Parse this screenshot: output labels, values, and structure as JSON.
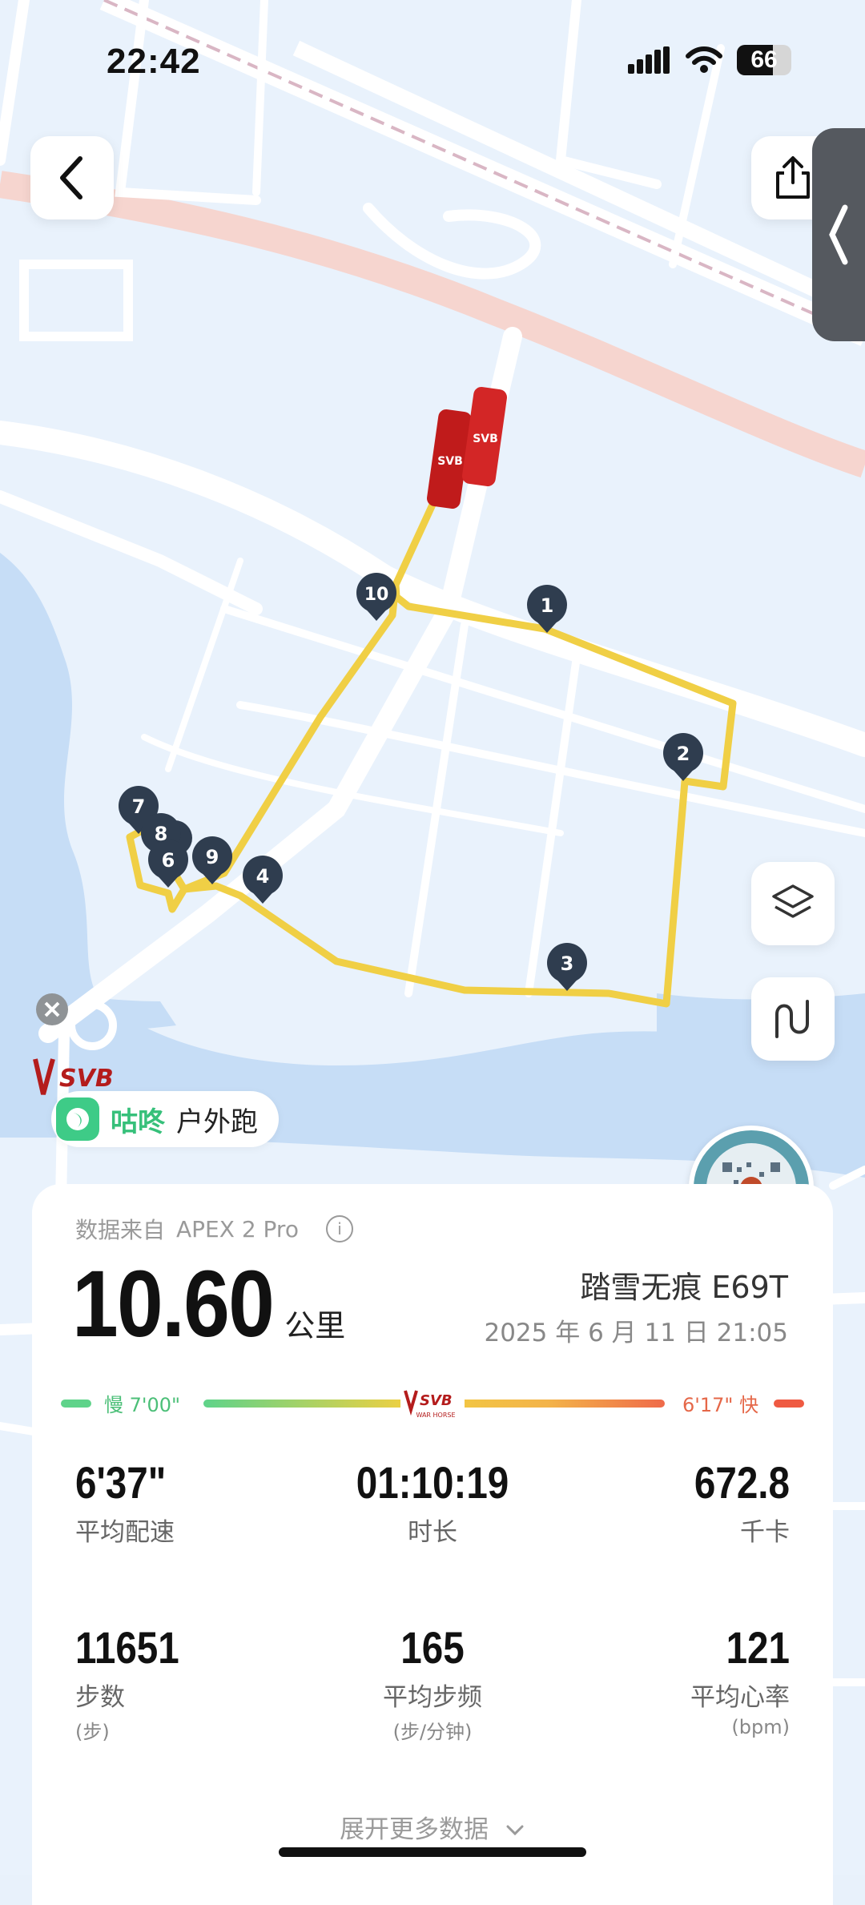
{
  "status_bar": {
    "time": "22:42",
    "battery": "66"
  },
  "route": {
    "markers": [
      "1",
      "2",
      "3",
      "4",
      "6",
      "7",
      "8",
      "9",
      "10"
    ],
    "start_badge_text": "SVB"
  },
  "brand": {
    "app_name": "咕咚",
    "activity": "户外跑",
    "sponsor_text": "SVB"
  },
  "summary": {
    "source_label": "数据来自",
    "device": "APEX 2 Pro",
    "distance": "10.60",
    "distance_unit": "公里",
    "shoe": "踏雪无痕 E69T",
    "datetime": "2025 年 6 月 11 日 21:05"
  },
  "pace_range": {
    "slow_label": "慢 7'00\"",
    "fast_label": "6'17\" 快",
    "center_logo_text": "SVB",
    "center_logo_sub": "WAR HORSE",
    "colors": {
      "slow": "#5fd38a",
      "fast": "#ef5a42"
    }
  },
  "stats": [
    {
      "value": "6'37\"",
      "label": "平均配速"
    },
    {
      "value": "01:10:19",
      "label": "时长"
    },
    {
      "value": "672.8",
      "label": "千卡"
    },
    {
      "value": "11651",
      "label": "步数",
      "unit": "(步)"
    },
    {
      "value": "165",
      "label": "平均步频",
      "unit": "(步/分钟)"
    },
    {
      "value": "121",
      "label": "平均心率",
      "unit": "(bpm)"
    }
  ],
  "expand_label": "展开更多数据",
  "colors": {
    "route": "#f0cf45",
    "marker": "#2f3d4f",
    "water": "#c5dcf5",
    "accent_green": "#36c07a"
  }
}
